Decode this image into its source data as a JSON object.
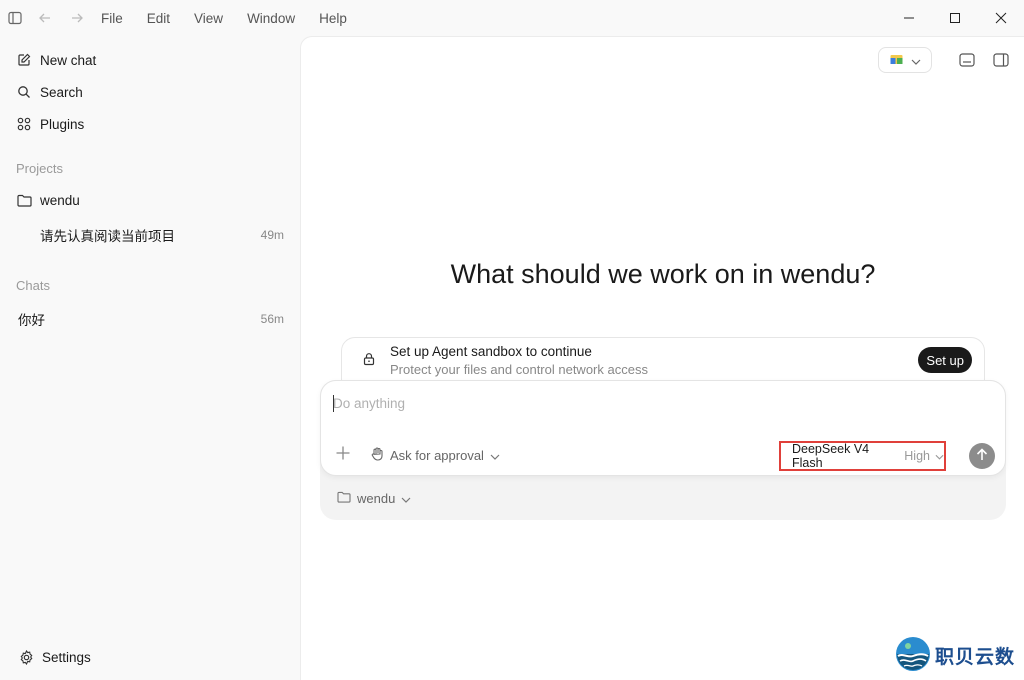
{
  "menu": [
    "File",
    "Edit",
    "View",
    "Window",
    "Help"
  ],
  "sidebar": {
    "new_chat": "New chat",
    "search": "Search",
    "plugins": "Plugins",
    "projects_label": "Projects",
    "project_name": "wendu",
    "project_chat": {
      "title": "请先认真阅读当前项目",
      "time": "49m"
    },
    "chats_label": "Chats",
    "chat": {
      "title": "你好",
      "time": "56m"
    },
    "settings": "Settings"
  },
  "main": {
    "headline": "What should we work on in wendu?",
    "sandbox": {
      "title": "Set up Agent sandbox to continue",
      "subtitle": "Protect your files and control network access",
      "button": "Set up"
    },
    "composer": {
      "placeholder": "Do anything",
      "approval": "Ask for approval",
      "model": "DeepSeek V4 Flash",
      "level": "High",
      "folder": "wendu"
    }
  },
  "watermark": "职贝云数",
  "colors": {
    "highlight_border": "#e0403a",
    "send_button": "#8c8c8c",
    "setup_button": "#1a1a1a"
  }
}
